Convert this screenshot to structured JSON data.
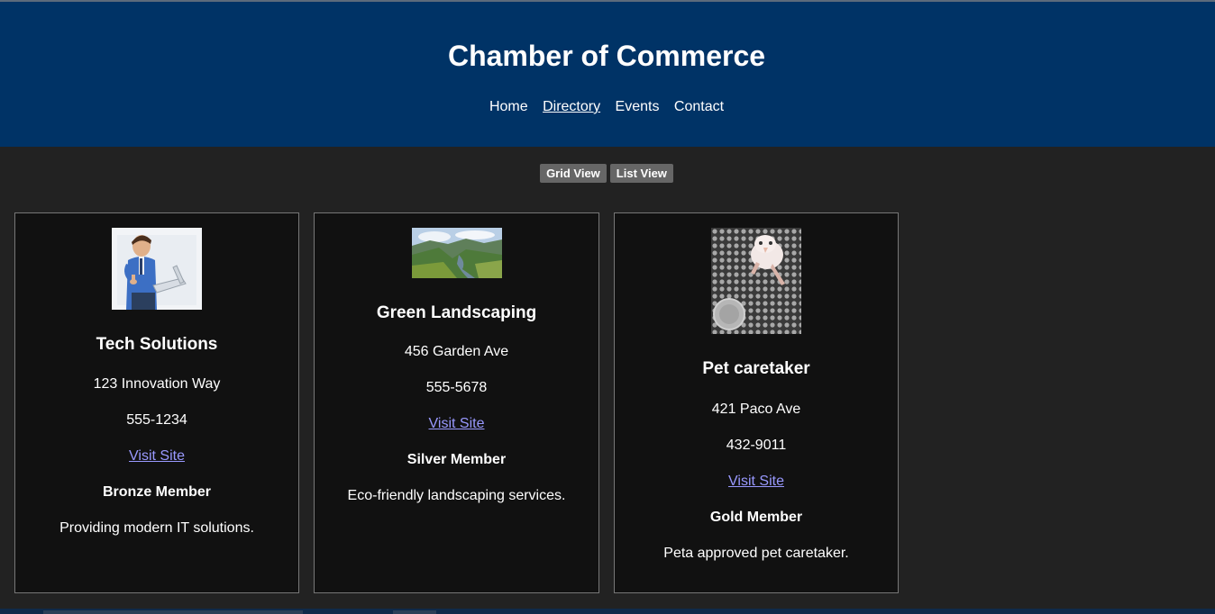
{
  "header": {
    "title": "Chamber of Commerce",
    "nav": [
      {
        "label": "Home"
      },
      {
        "label": "Directory"
      },
      {
        "label": "Events"
      },
      {
        "label": "Contact"
      }
    ]
  },
  "view_toggle": {
    "grid_label": "Grid View",
    "list_label": "List View"
  },
  "members": [
    {
      "name": "Tech Solutions",
      "address": "123 Innovation Way",
      "phone": "555-1234",
      "link_label": "Visit Site",
      "membership": "Bronze Member",
      "description": "Providing modern IT solutions.",
      "image": "businessman-with-laptop-photo"
    },
    {
      "name": "Green Landscaping",
      "address": "456 Garden Ave",
      "phone": "555-5678",
      "link_label": "Visit Site",
      "membership": "Silver Member",
      "description": "Eco-friendly landscaping services.",
      "image": "river-valley-landscape-photo"
    },
    {
      "name": "Pet caretaker",
      "address": "421 Paco Ave",
      "phone": "432-9011",
      "link_label": "Visit Site",
      "membership": "Gold Member",
      "description": "Peta approved pet caretaker.",
      "image": "baby-bird-with-coin-photo"
    }
  ],
  "colors": {
    "header_bg": "#003366",
    "page_bg": "#222222",
    "card_bg": "#111111",
    "link": "#9999ff"
  }
}
